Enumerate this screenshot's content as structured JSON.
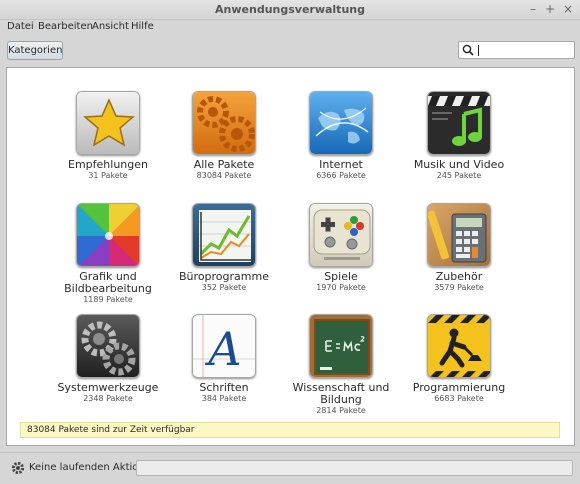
{
  "window": {
    "title": "Anwendungsverwaltung"
  },
  "menu": [
    "Datei",
    "Bearbeiten",
    "Ansicht",
    "Hilfe"
  ],
  "toolbar": {
    "categories_label": "Kategorien",
    "search_value": ""
  },
  "categories": [
    {
      "name": "Empfehlungen",
      "count": "31 Pakete",
      "icon": "star-icon"
    },
    {
      "name": "Alle Pakete",
      "count": "83084 Pakete",
      "icon": "gears-icon"
    },
    {
      "name": "Internet",
      "count": "6366 Pakete",
      "icon": "globe-icon"
    },
    {
      "name": "Musik und Video",
      "count": "245 Pakete",
      "icon": "music-video-icon"
    },
    {
      "name": "Grafik und Bildbearbeitung",
      "count": "1189 Pakete",
      "icon": "color-wheel-icon"
    },
    {
      "name": "Büroprogramme",
      "count": "352 Pakete",
      "icon": "chart-icon"
    },
    {
      "name": "Spiele",
      "count": "1970 Pakete",
      "icon": "gamepad-icon"
    },
    {
      "name": "Zubehör",
      "count": "3579 Pakete",
      "icon": "calculator-icon"
    },
    {
      "name": "Systemwerkzeuge",
      "count": "2348 Pakete",
      "icon": "system-gears-icon"
    },
    {
      "name": "Schriften",
      "count": "384 Pakete",
      "icon": "font-icon"
    },
    {
      "name": "Wissenschaft und Bildung",
      "count": "2814 Pakete",
      "icon": "chalkboard-icon"
    },
    {
      "name": "Programmierung",
      "count": "6683 Pakete",
      "icon": "construction-icon"
    }
  ],
  "status_message": "83084 Pakete sind zur Zeit verfügbar",
  "bottom": {
    "actions_label": "Keine laufenden Aktionen",
    "progress": 0
  },
  "colors": {
    "status_bg": "#fcf8c4",
    "window_bg": "#d6d6d6"
  }
}
